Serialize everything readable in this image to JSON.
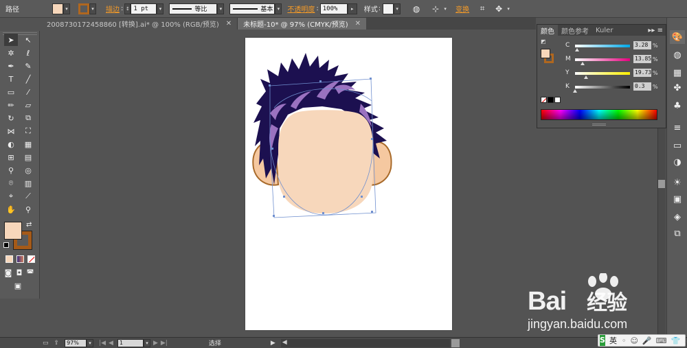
{
  "control_bar": {
    "object_type": "路径",
    "fill_color": "#f7d7bb",
    "stroke_color": "#b0671f",
    "stroke_label": "描边",
    "stroke_weight": "1 pt",
    "brush_profile_label": "等比",
    "brush_style_label": "基本",
    "opacity_label": "不透明度",
    "opacity_value": "100%",
    "style_label": "样式",
    "transform_label": "变换"
  },
  "tabs": [
    {
      "label": "2008730172458860 [转换].ai* @ 100% (RGB/预览)",
      "active": false
    },
    {
      "label": "未标题-10* @ 97% (CMYK/预览)",
      "active": true
    }
  ],
  "tools": {
    "fill_color": "#f7d7bb",
    "stroke_color": "#a55a18"
  },
  "color_panel": {
    "tabs": [
      "颜色",
      "颜色参考",
      "Kuler"
    ],
    "sliders": [
      {
        "channel": "C",
        "value": "3.28",
        "pct": 3.28
      },
      {
        "channel": "M",
        "value": "13.85",
        "pct": 13.85
      },
      {
        "channel": "Y",
        "value": "19.73",
        "pct": 19.73
      },
      {
        "channel": "K",
        "value": "0.3",
        "pct": 0.3
      }
    ],
    "percent_sign": "%"
  },
  "status_bar": {
    "zoom": "97%",
    "page": "1",
    "mode": "选择"
  },
  "watermark": {
    "brand": "Bai",
    "brand2": "经验",
    "url": "jingyan.baidu.com"
  },
  "ime": {
    "logo": "S",
    "lang": "英"
  },
  "colors": {
    "hair": "#1c1050",
    "hair_highlight": "#9a72c0",
    "skin": "#f7d7bb",
    "ear_outline": "#a86a2a",
    "ear_fill": "#f5c8a0",
    "selection": "#6f8fcf"
  }
}
